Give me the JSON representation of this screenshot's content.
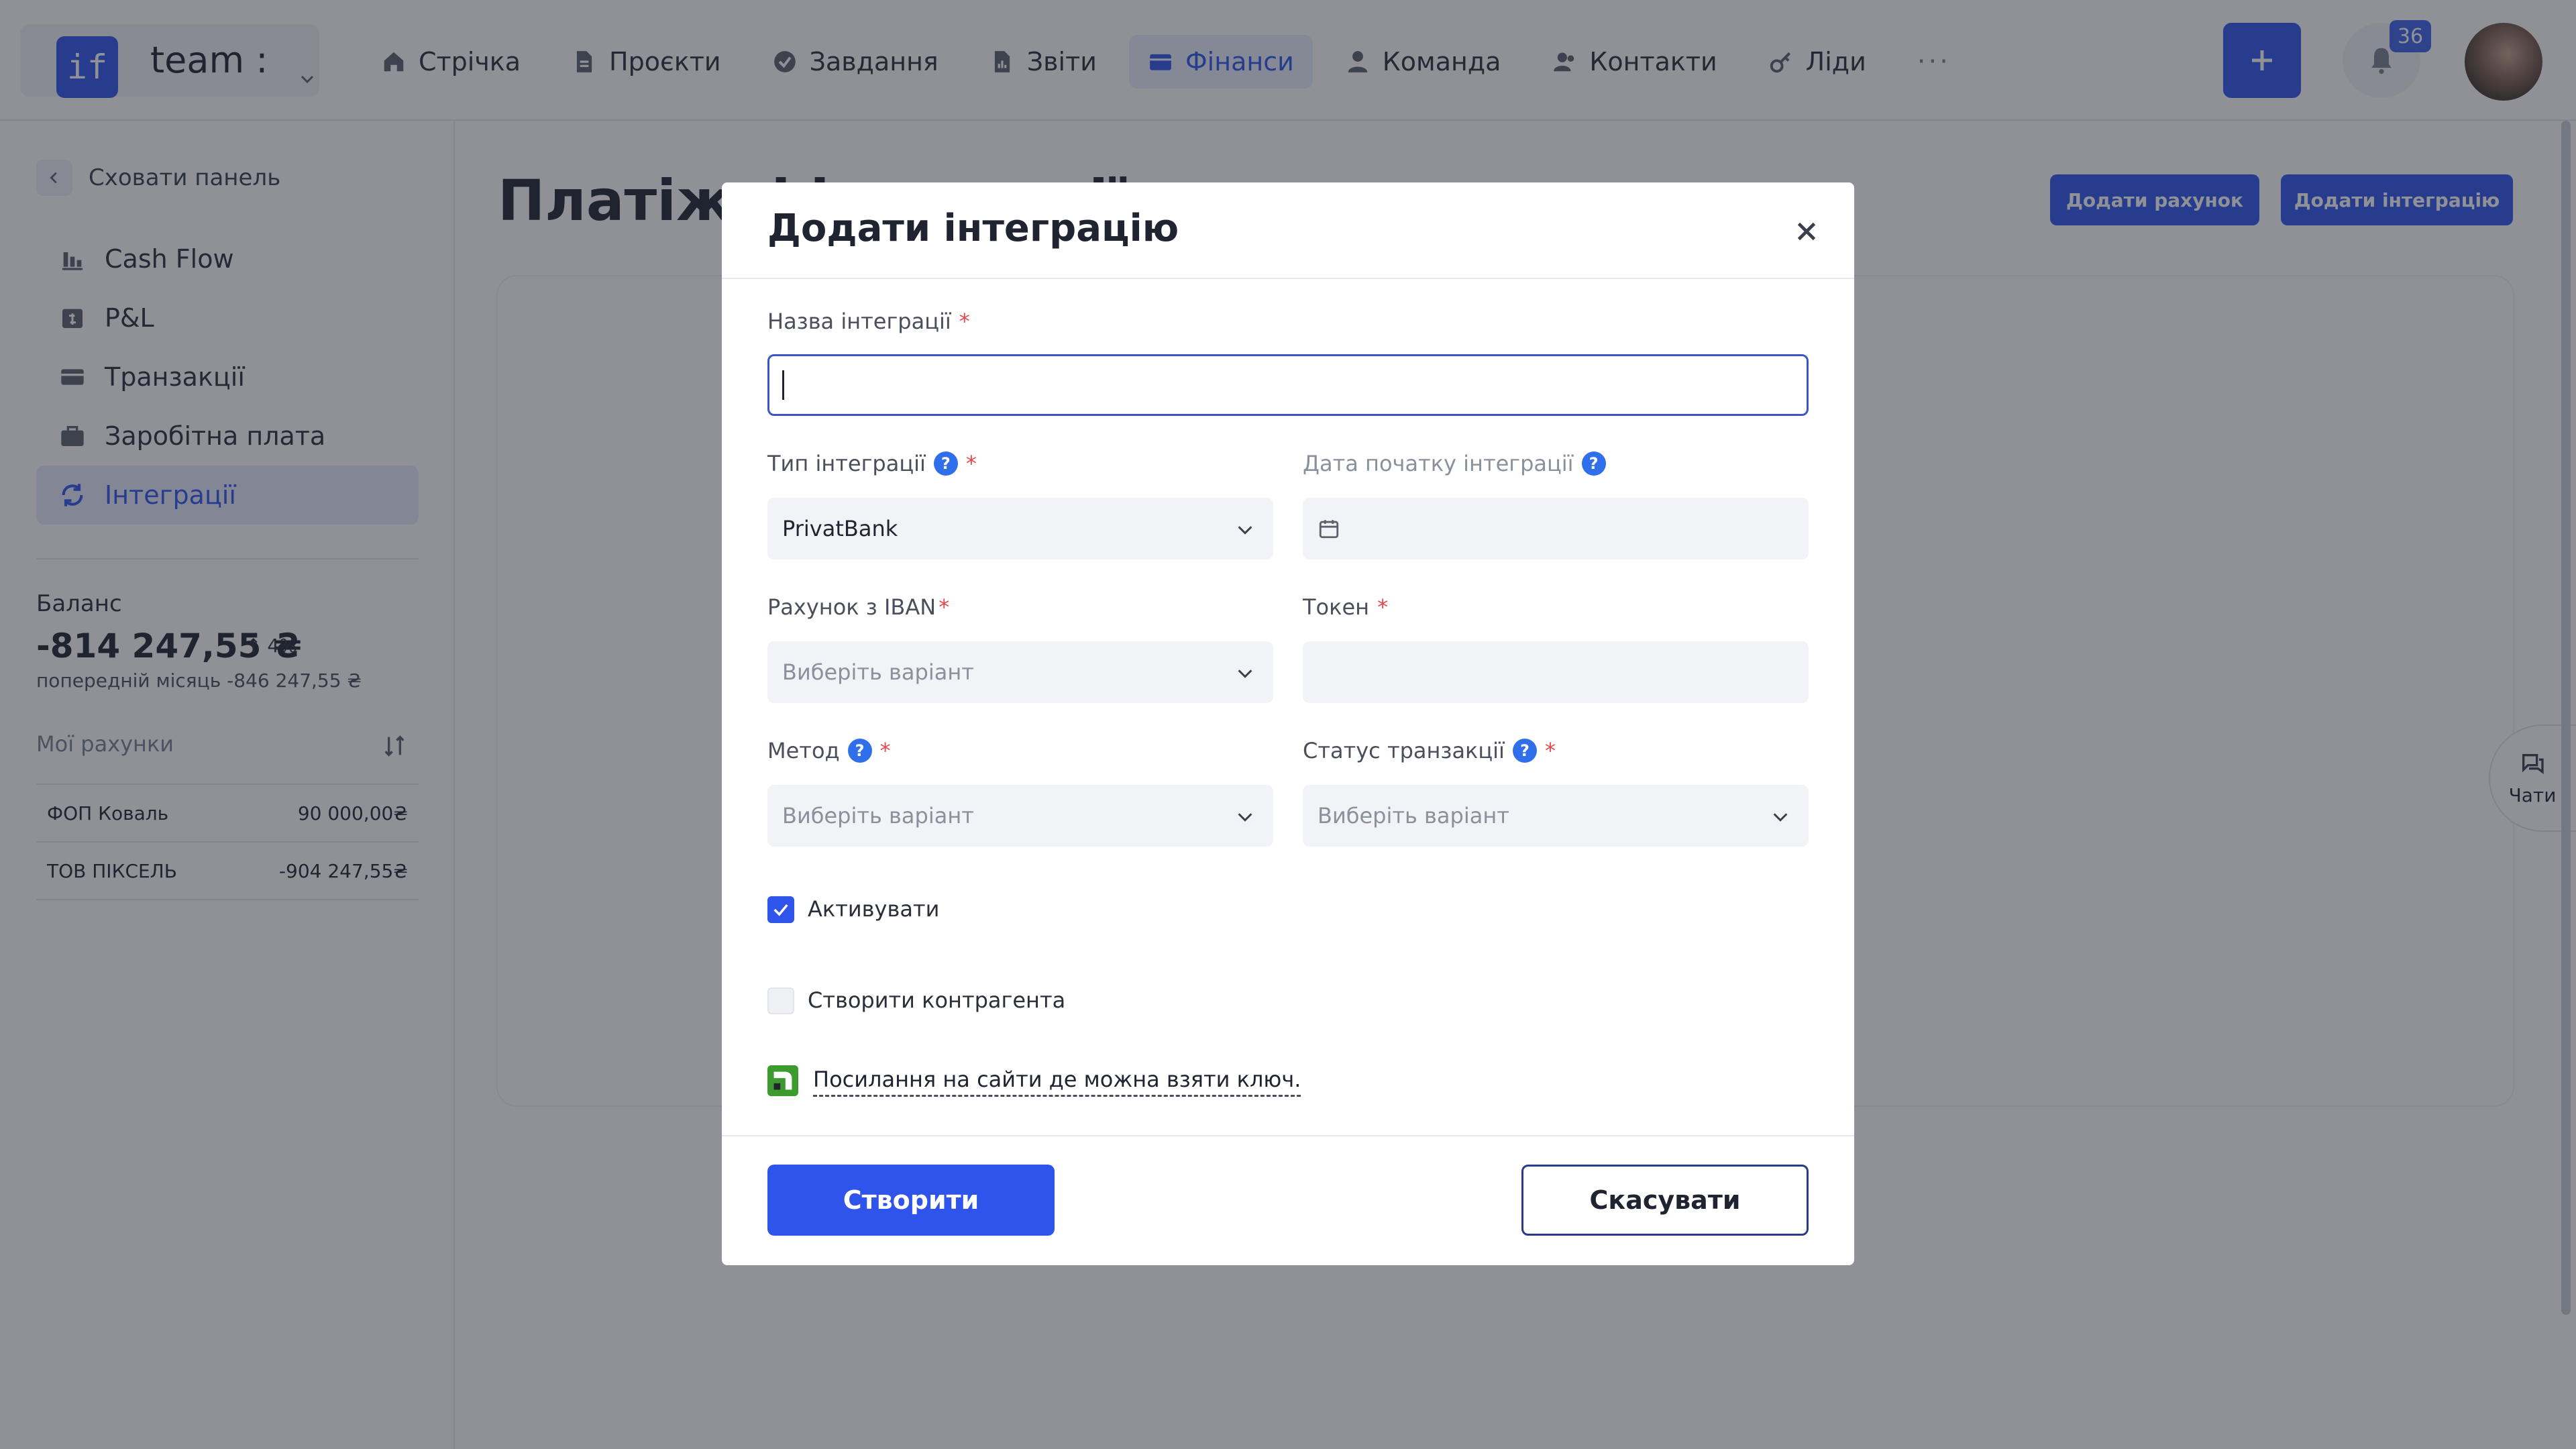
{
  "topbar": {
    "team": {
      "logo_text": "if",
      "name": "team :"
    },
    "nav": [
      {
        "id": "feed",
        "label": "Стрічка",
        "icon": "home-icon"
      },
      {
        "id": "projects",
        "label": "Проєкти",
        "icon": "document-icon"
      },
      {
        "id": "tasks",
        "label": "Завдання",
        "icon": "check-circle-icon"
      },
      {
        "id": "reports",
        "label": "Звіти",
        "icon": "chart-icon"
      },
      {
        "id": "finance",
        "label": "Фінанси",
        "icon": "wallet-icon",
        "active": true
      },
      {
        "id": "team",
        "label": "Команда",
        "icon": "user-icon"
      },
      {
        "id": "contacts",
        "label": "Контакти",
        "icon": "users-icon"
      },
      {
        "id": "leads",
        "label": "Ліди",
        "icon": "key-icon"
      }
    ],
    "more": "···",
    "notifications_count": "36"
  },
  "sidebar": {
    "hide_panel": "Сховати панель",
    "menu": [
      {
        "label": "Cash Flow",
        "icon": "bar-chart-icon"
      },
      {
        "label": "P&L",
        "icon": "calendar-dollar-icon"
      },
      {
        "label": "Транзакції",
        "icon": "card-icon"
      },
      {
        "label": "Заробітна плата",
        "icon": "briefcase-icon"
      },
      {
        "label": "Інтеграції",
        "icon": "sync-icon",
        "active": true
      }
    ],
    "balance": {
      "label": "Баланс",
      "value": "-814 247,55 ₴",
      "change": "4%",
      "previous": "попередній місяць -846 247,55 ₴"
    },
    "accounts": {
      "title": "Мої рахунки",
      "items": [
        {
          "name": "ФОП Коваль",
          "amount": "90 000,00₴"
        },
        {
          "name": "ТОВ ПІКСЕЛЬ",
          "amount": "-904 247,55₴"
        }
      ]
    }
  },
  "main": {
    "page_title": "Платіжні інтеграції",
    "add_account": "Додати рахунок",
    "add_integration": "Додати інтеграцію",
    "chats": "Чати"
  },
  "modal": {
    "title": "Додати інтеграцію",
    "name": {
      "label": "Назва інтеграції",
      "required": "*",
      "value": "",
      "placeholder": ""
    },
    "type": {
      "label": "Тип інтеграції",
      "required": "*",
      "value": "PrivatBank"
    },
    "start_date": {
      "label": "Дата початку інтеграції",
      "value": ""
    },
    "iban": {
      "label": "Рахунок з IBAN",
      "required": "*",
      "placeholder": "Виберіть варіант"
    },
    "token": {
      "label": "Токен",
      "required": "*",
      "value": ""
    },
    "method": {
      "label": "Метод",
      "required": "*",
      "placeholder": "Виберіть варіант"
    },
    "tx_status": {
      "label": "Статус транзакції",
      "required": "*",
      "placeholder": "Виберіть варіант"
    },
    "activate": {
      "label": "Активувати",
      "checked": true
    },
    "create_counterparty": {
      "label": "Створити контрагента",
      "checked": false
    },
    "key_link": "Посилання на сайти де можна взяти ключ.",
    "create_button": "Створити",
    "cancel_button": "Скасувати",
    "help_glyph": "?"
  },
  "colors": {
    "primary": "#2f54eb",
    "required": "#e5484d",
    "overlay": "rgba(32,36,48,0.5)"
  }
}
